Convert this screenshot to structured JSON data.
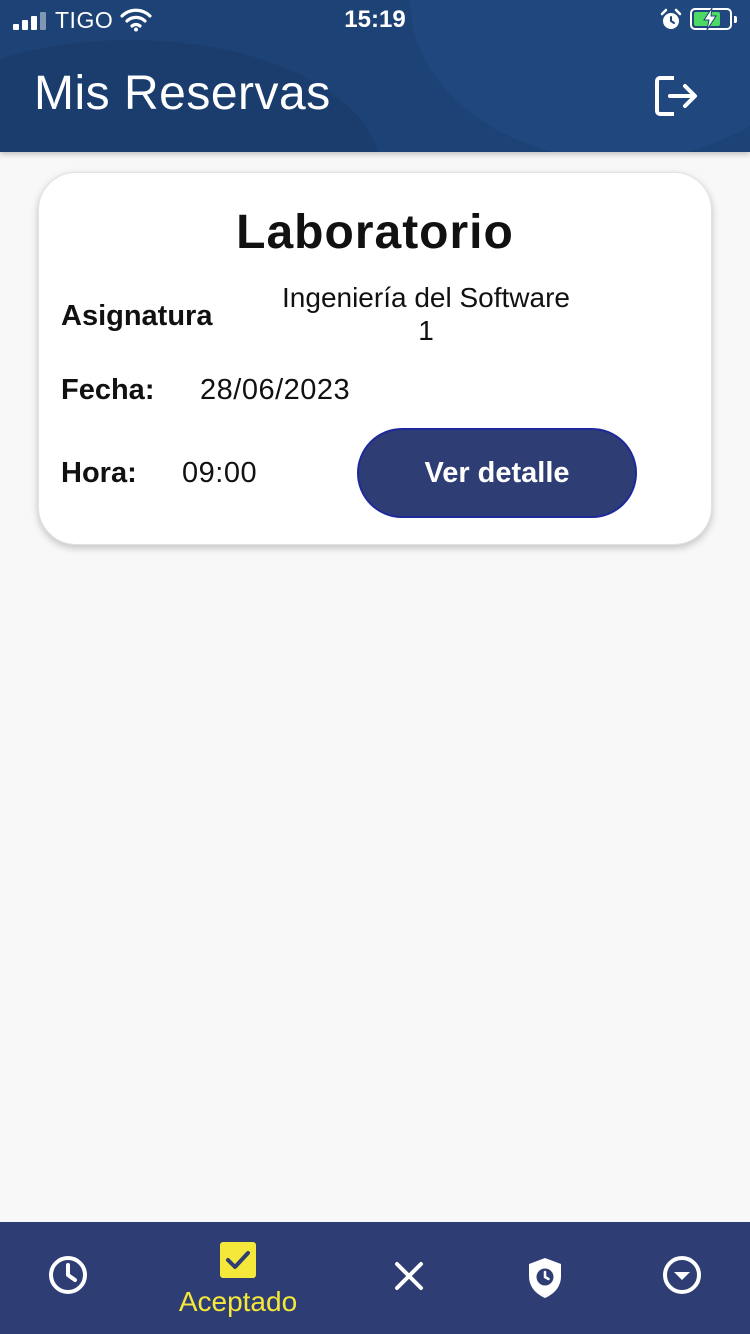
{
  "status": {
    "carrier": "TIGO",
    "time": "15:19"
  },
  "header": {
    "title": "Mis Reservas",
    "logout_icon": "logout-icon"
  },
  "reservation": {
    "title": "Laboratorio",
    "subject_label": "Asignatura",
    "subject_line1": "Ingeniería del Software",
    "subject_line2": "1",
    "date_label": "Fecha:",
    "date_value": "28/06/2023",
    "time_label": "Hora:",
    "time_value": "09:00",
    "detail_button": "Ver detalle"
  },
  "tabs": [
    {
      "icon": "clock-icon"
    },
    {
      "icon": "check-box-icon",
      "label": "Aceptado",
      "active": true
    },
    {
      "icon": "close-icon"
    },
    {
      "icon": "shield-clock-icon"
    },
    {
      "icon": "circle-chevron-down-icon"
    }
  ],
  "colors": {
    "header_bg": "#1d4275",
    "tabbar_bg": "#2e3d73",
    "button_bg": "#2e3d73",
    "active_tab": "#f5e83a",
    "battery": "#4cd964"
  }
}
